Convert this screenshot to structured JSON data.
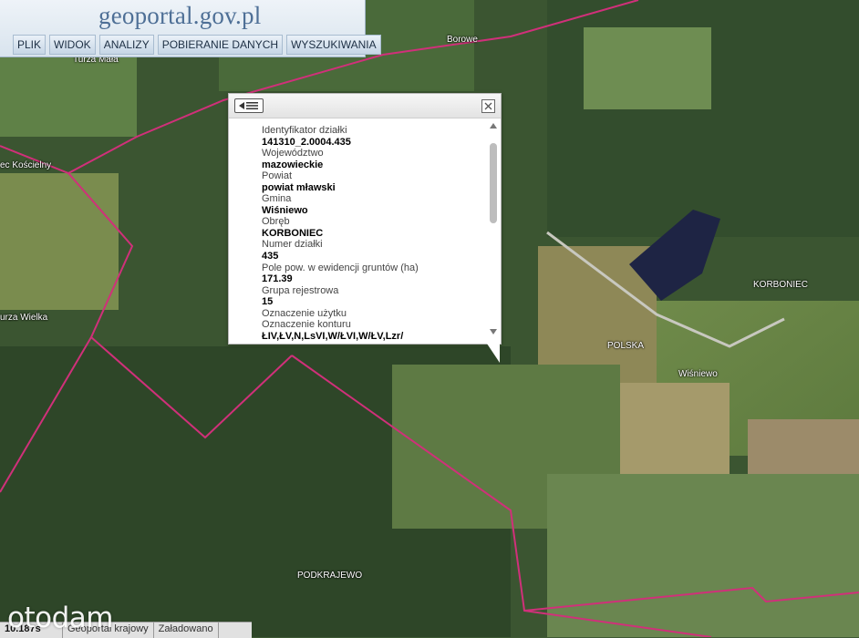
{
  "header": {
    "logo_text": "geoportal.gov.pl",
    "menu": [
      "PLIK",
      "WIDOK",
      "ANALIZY",
      "POBIERANIE DANYCH",
      "WYSZUKIWANIA"
    ]
  },
  "map_labels": {
    "borowe": "Borowe",
    "turza_mala": "Turza Mała",
    "ec_koscielny": "ec Kościelny",
    "turza_wielka": "urza Wielka",
    "korboniec": "KORBONIEC",
    "polska": "POLSKA",
    "wisniewo": "Wiśniewo",
    "podkrajewo": "PODKRAJEWO"
  },
  "popup": {
    "fields": [
      {
        "label": "Identyfikator działki",
        "value": "141310_2.0004.435"
      },
      {
        "label": "Województwo",
        "value": "mazowieckie"
      },
      {
        "label": "Powiat",
        "value": "powiat mławski"
      },
      {
        "label": "Gmina",
        "value": "Wiśniewo"
      },
      {
        "label": "Obręb",
        "value": "KORBONIEC"
      },
      {
        "label": "Numer działki",
        "value": "435"
      },
      {
        "label": "Pole pow. w ewidencji gruntów (ha)",
        "value": "171.39"
      },
      {
        "label": "Grupa rejestrowa",
        "value": "15"
      },
      {
        "label": "Oznaczenie użytku",
        "value": ""
      },
      {
        "label": "Oznaczenie konturu",
        "value": "ŁIV,ŁV,N,LsVI,W/ŁVI,W/ŁV,Lzr/"
      }
    ]
  },
  "status": {
    "scale": "10.187s",
    "source": "Geoportal krajowy",
    "state": "Załadowano"
  },
  "watermark": "otodam",
  "colors": {
    "boundary": "#d0307a",
    "header_text": "#4e6f96"
  }
}
